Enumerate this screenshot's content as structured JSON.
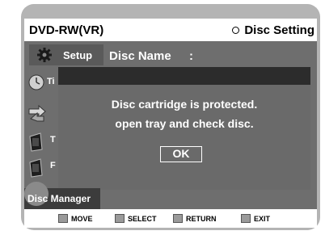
{
  "header": {
    "mode": "DVD-RW(VR)",
    "section": "Disc Setting"
  },
  "setup": {
    "tab_label": "Setup",
    "field_label": "Disc Name",
    "field_separator": ":"
  },
  "sidebar": {
    "items": [
      {
        "label": "Ti",
        "icon": "clock-icon"
      },
      {
        "label": "",
        "icon": "arrows-icon"
      },
      {
        "label": "T",
        "icon": "film-icon"
      },
      {
        "label": "F",
        "icon": "film-icon"
      }
    ],
    "bottom_label": "Disc Manager"
  },
  "dialog": {
    "line1": "Disc cartridge is protected.",
    "line2": "open tray and check disc.",
    "ok_label": "OK"
  },
  "footer": {
    "move_label": "MOVE",
    "select_label": "SELECT",
    "return_label": "RETURN",
    "exit_label": "EXIT"
  },
  "colors": {
    "background": "#6e6e6e",
    "dialog": "#6a6a6a",
    "dialog_header": "#2c2c2c",
    "title_bar": "#ffffff",
    "text": "#ffffff"
  }
}
